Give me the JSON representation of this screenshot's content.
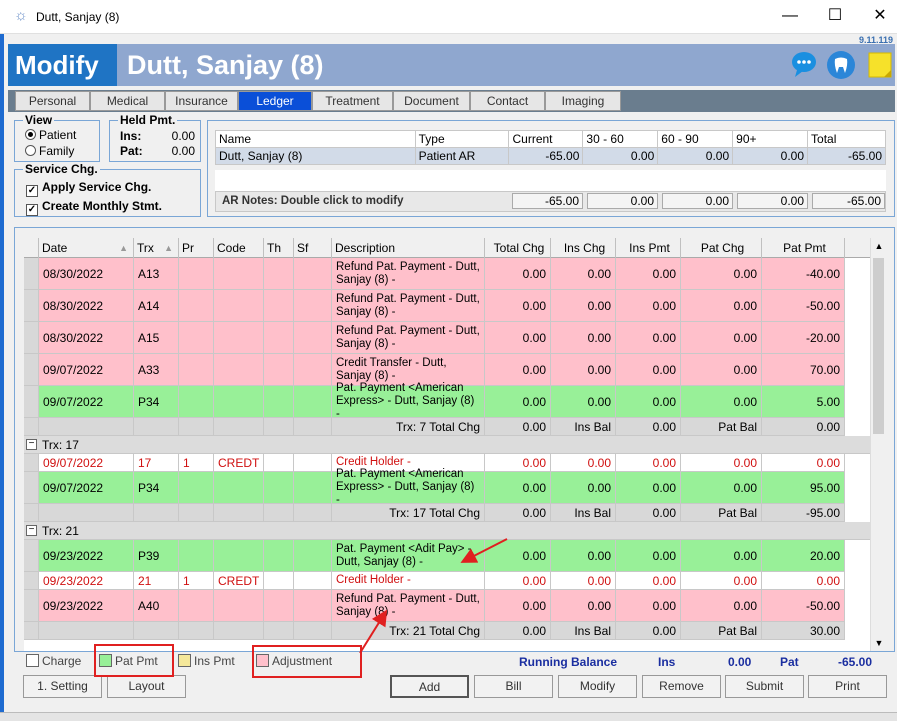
{
  "window": {
    "title": "Dutt, Sanjay (8)",
    "version": "9.11.119"
  },
  "header": {
    "mode": "Modify",
    "patient": "Dutt, Sanjay (8)"
  },
  "tabs": [
    "Personal",
    "Medical",
    "Insurance",
    "Ledger",
    "Treatment",
    "Document",
    "Contact",
    "Imaging"
  ],
  "view": {
    "title": "View",
    "patient": "Patient",
    "family": "Family"
  },
  "held": {
    "title": "Held Pmt.",
    "ins_label": "Ins:",
    "ins_value": "0.00",
    "pat_label": "Pat:",
    "pat_value": "0.00"
  },
  "service": {
    "title": "Service Chg.",
    "apply": "Apply Service Chg.",
    "monthly": "Create Monthly Stmt."
  },
  "ar": {
    "headers": [
      "Name",
      "Type",
      "Current",
      "30 - 60",
      "60 - 90",
      "90+",
      "Total"
    ],
    "row": [
      "Dutt, Sanjay (8)",
      "Patient AR",
      "-65.00",
      "0.00",
      "0.00",
      "0.00",
      "-65.00"
    ],
    "notes_label": "AR Notes: Double click to modify",
    "totals": [
      "-65.00",
      "0.00",
      "0.00",
      "0.00",
      "-65.00"
    ]
  },
  "grid": {
    "headers": [
      "Date",
      "Trx",
      "Pr",
      "Code",
      "Th",
      "Sf",
      "Description",
      "Total Chg",
      "Ins Chg",
      "Ins Pmt",
      "Pat Chg",
      "Pat Pmt"
    ]
  },
  "rows": [
    {
      "date": "08/30/2022",
      "trx": "A13",
      "pr": "",
      "code": "",
      "desc": "Refund Pat. Payment - Dutt, Sanjay (8) -",
      "tc": "0.00",
      "ic": "0.00",
      "ip": "0.00",
      "pc": "0.00",
      "pp": "-40.00",
      "kind": "adj"
    },
    {
      "date": "08/30/2022",
      "trx": "A14",
      "pr": "",
      "code": "",
      "desc": "Refund Pat. Payment - Dutt, Sanjay (8) -",
      "tc": "0.00",
      "ic": "0.00",
      "ip": "0.00",
      "pc": "0.00",
      "pp": "-50.00",
      "kind": "adj"
    },
    {
      "date": "08/30/2022",
      "trx": "A15",
      "pr": "",
      "code": "",
      "desc": "Refund Pat. Payment - Dutt, Sanjay (8) -",
      "tc": "0.00",
      "ic": "0.00",
      "ip": "0.00",
      "pc": "0.00",
      "pp": "-20.00",
      "kind": "adj"
    },
    {
      "date": "09/07/2022",
      "trx": "A33",
      "pr": "",
      "code": "",
      "desc": "Credit Transfer - Dutt, Sanjay (8) -",
      "tc": "0.00",
      "ic": "0.00",
      "ip": "0.00",
      "pc": "0.00",
      "pp": "70.00",
      "kind": "adj"
    },
    {
      "date": "09/07/2022",
      "trx": "P34",
      "pr": "",
      "code": "",
      "desc": "Pat. Payment <American Express> - Dutt, Sanjay (8) -",
      "tc": "0.00",
      "ic": "0.00",
      "ip": "0.00",
      "pc": "0.00",
      "pp": "5.00",
      "kind": "pay"
    },
    {
      "kind": "sum",
      "label": "Trx: 7 Total Chg",
      "tc": "0.00",
      "inslbl": "Ins Bal",
      "ip": "0.00",
      "patlbl": "Pat Bal",
      "pp": "0.00"
    },
    {
      "kind": "grp",
      "label": "Trx: 17"
    },
    {
      "date": "09/07/2022",
      "trx": "17",
      "pr": "1",
      "code": "CREDT",
      "desc": "Credit Holder -",
      "tc": "0.00",
      "ic": "0.00",
      "ip": "0.00",
      "pc": "0.00",
      "pp": "0.00",
      "kind": "credit"
    },
    {
      "date": "09/07/2022",
      "trx": "P34",
      "pr": "",
      "code": "",
      "desc": "Pat. Payment <American Express> - Dutt, Sanjay (8) -",
      "tc": "0.00",
      "ic": "0.00",
      "ip": "0.00",
      "pc": "0.00",
      "pp": "95.00",
      "kind": "pay"
    },
    {
      "kind": "sum",
      "label": "Trx: 17 Total Chg",
      "tc": "0.00",
      "inslbl": "Ins Bal",
      "ip": "0.00",
      "patlbl": "Pat Bal",
      "pp": "-95.00"
    },
    {
      "kind": "grp",
      "label": "Trx: 21"
    },
    {
      "date": "09/23/2022",
      "trx": "P39",
      "pr": "",
      "code": "",
      "desc": "Pat. Payment <Adit Pay> - Dutt, Sanjay (8) -",
      "tc": "0.00",
      "ic": "0.00",
      "ip": "0.00",
      "pc": "0.00",
      "pp": "20.00",
      "kind": "pay"
    },
    {
      "date": "09/23/2022",
      "trx": "21",
      "pr": "1",
      "code": "CREDT",
      "desc": "Credit Holder -",
      "tc": "0.00",
      "ic": "0.00",
      "ip": "0.00",
      "pc": "0.00",
      "pp": "0.00",
      "kind": "credit"
    },
    {
      "date": "09/23/2022",
      "trx": "A40",
      "pr": "",
      "code": "",
      "desc": "Refund Pat. Payment - Dutt, Sanjay (8) -",
      "tc": "0.00",
      "ic": "0.00",
      "ip": "0.00",
      "pc": "0.00",
      "pp": "-50.00",
      "kind": "adj"
    },
    {
      "kind": "sum",
      "label": "Trx: 21 Total Chg",
      "tc": "0.00",
      "inslbl": "Ins Bal",
      "ip": "0.00",
      "patlbl": "Pat Bal",
      "pp": "30.00"
    }
  ],
  "legend": {
    "charge": "Charge",
    "patpmt": "Pat Pmt",
    "inspmt": "Ins Pmt",
    "adjustment": "Adjustment"
  },
  "running": {
    "label": "Running Balance",
    "ins_label": "Ins",
    "ins_value": "0.00",
    "pat_label": "Pat",
    "pat_value": "-65.00"
  },
  "buttons": {
    "setting": "1. Setting",
    "layout": "Layout",
    "add": "Add",
    "bill": "Bill",
    "modify": "Modify",
    "remove": "Remove",
    "submit": "Submit",
    "print": "Print"
  },
  "colors": {
    "adj": "#ffc0cb",
    "pay": "#98f098",
    "credit": "#ffffff",
    "sum": "#d8d8d8",
    "charge": "#ffffff",
    "inspmt": "#f5e89a",
    "accent": "#1f74c4"
  }
}
